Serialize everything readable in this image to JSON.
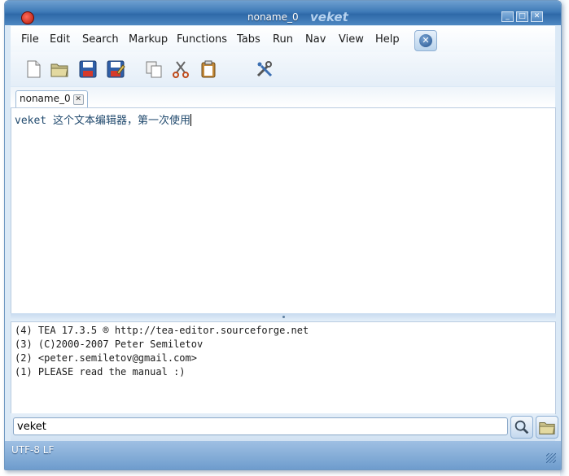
{
  "window": {
    "title": "noname_0",
    "app_name": "veket",
    "controls": [
      "minimize",
      "maximize",
      "close"
    ]
  },
  "menu": {
    "items": [
      "File",
      "Edit",
      "Search",
      "Markup",
      "Functions",
      "Tabs",
      "Run",
      "Nav",
      "View",
      "Help"
    ]
  },
  "toolbar": {
    "buttons": [
      "new-document-icon",
      "open-folder-icon",
      "save-icon",
      "save-as-icon",
      "copy-icon",
      "cut-icon",
      "paste-icon",
      "tools-icon"
    ]
  },
  "tabs": [
    {
      "label": "noname_0",
      "active": true
    }
  ],
  "editor": {
    "text": "veket 这个文本编辑器，第一次使用"
  },
  "log": {
    "lines": [
      "(4) TEA 17.3.5 ® http://tea-editor.sourceforge.net",
      "(3) (C)2000-2007 Peter Semiletov",
      "(2) <peter.semiletov@gmail.com>",
      "(1) PLEASE read the manual :)"
    ]
  },
  "search": {
    "value": "veket"
  },
  "status": {
    "encoding": "UTF-8 LF"
  },
  "colors": {
    "titlebar": "#3f7ab7",
    "window_bg": "#dbe9f6",
    "statusbar": "#7aa6d4"
  }
}
